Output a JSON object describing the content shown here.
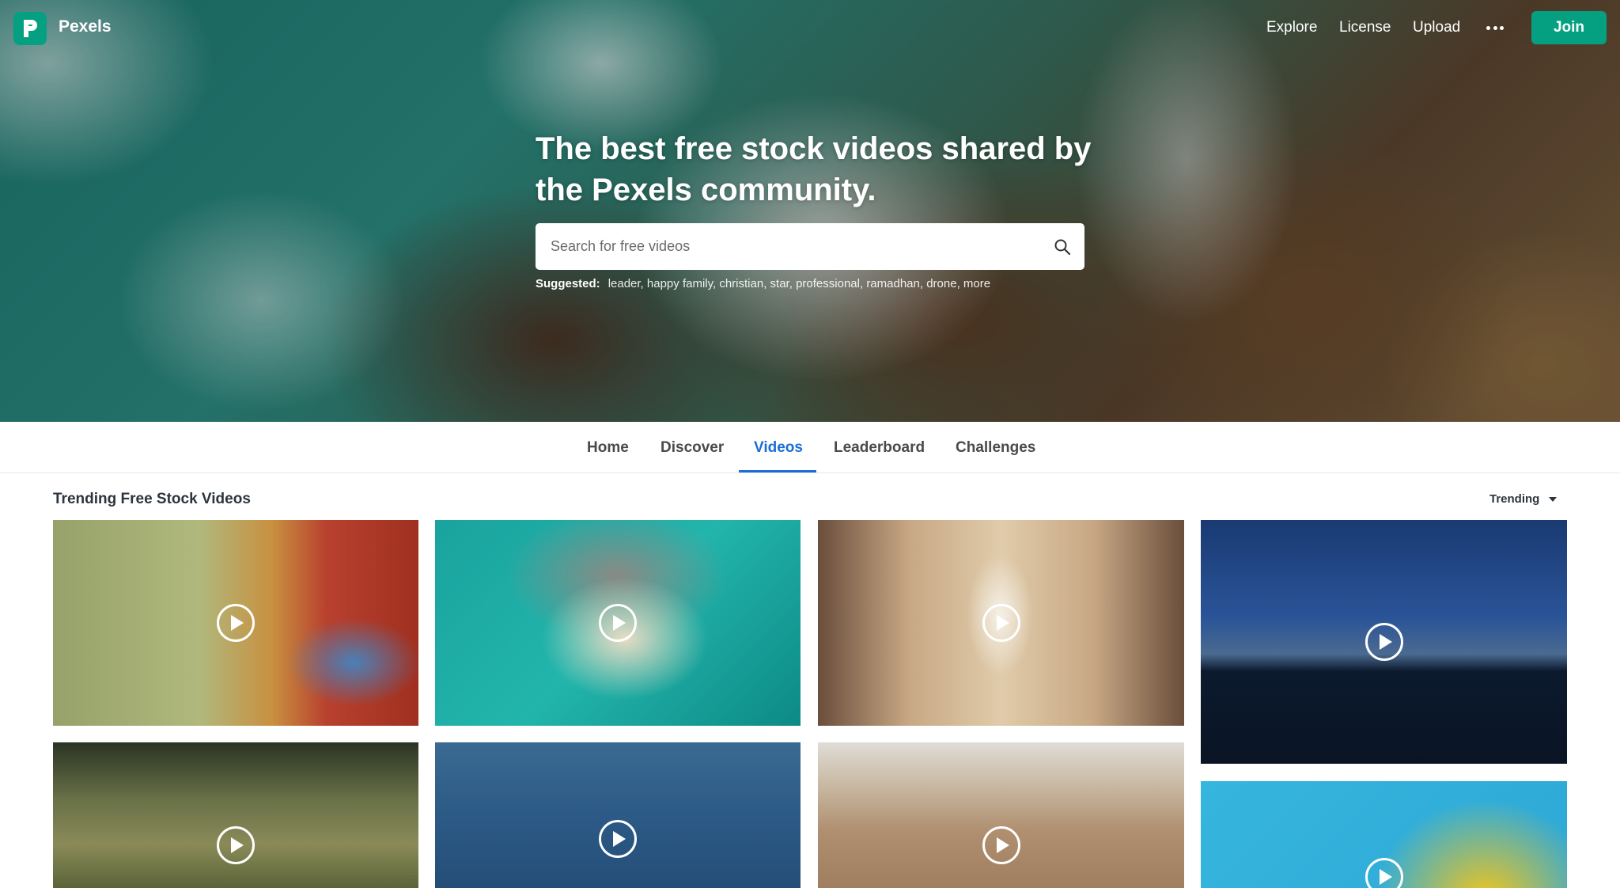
{
  "brand": {
    "name": "Pexels",
    "accent": "#05a081"
  },
  "nav": {
    "links": [
      "Explore",
      "License",
      "Upload"
    ],
    "more_icon": "more-dots-icon",
    "join_label": "Join"
  },
  "hero": {
    "title": "The best free stock videos shared by the Pexels community.",
    "search_placeholder": "Search for free videos",
    "search_icon": "search-icon",
    "suggested_label": "Suggested:",
    "suggested": [
      "leader,",
      "happy family,",
      "christian,",
      "star,",
      "professional,",
      "ramadhan,",
      "drone,",
      "more"
    ]
  },
  "tabs": {
    "items": [
      "Home",
      "Discover",
      "Videos",
      "Leaderboard",
      "Challenges"
    ],
    "active": "Videos",
    "active_color": "#1a6ed8"
  },
  "section": {
    "title": "Trending Free Stock Videos",
    "sort_label": "Trending"
  },
  "videos": {
    "play_icon": "play-icon",
    "count_visible": 8
  }
}
